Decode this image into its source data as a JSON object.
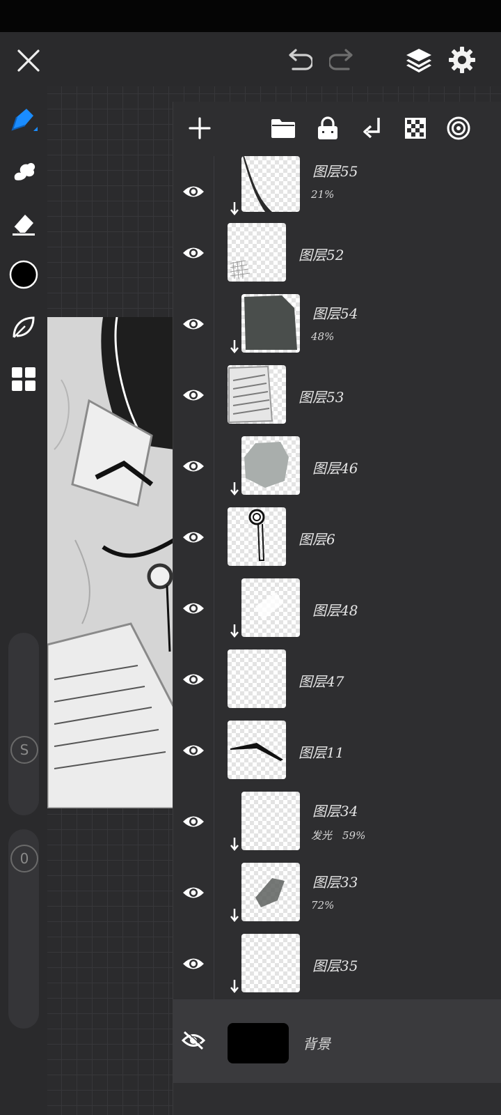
{
  "layers_panel": {
    "layers": [
      {
        "name": "图层55",
        "meta": "21%",
        "clipped": true
      },
      {
        "name": "图层52",
        "meta": "",
        "clipped": false
      },
      {
        "name": "图层54",
        "meta": "48%",
        "clipped": true
      },
      {
        "name": "图层53",
        "meta": "",
        "clipped": false
      },
      {
        "name": "图层46",
        "meta": "",
        "clipped": true
      },
      {
        "name": "图层6",
        "meta": "",
        "clipped": false
      },
      {
        "name": "图层48",
        "meta": "",
        "clipped": true
      },
      {
        "name": "图层47",
        "meta": "",
        "clipped": false
      },
      {
        "name": "图层11",
        "meta": "",
        "clipped": false
      },
      {
        "name": "图层34",
        "meta": "发光　59%",
        "clipped": true
      },
      {
        "name": "图层33",
        "meta": "72%",
        "clipped": true
      },
      {
        "name": "图层35",
        "meta": "",
        "clipped": true
      }
    ],
    "background_layer": {
      "name": "背景",
      "visible": false
    }
  },
  "toolbar": {
    "slider_size_label": "S",
    "slider_opacity_label": "0",
    "current_color": "#000000"
  },
  "colors": {
    "accent": "#1a8cff",
    "panel": "#2e2e30",
    "toolbar": "#2a2a2c"
  }
}
